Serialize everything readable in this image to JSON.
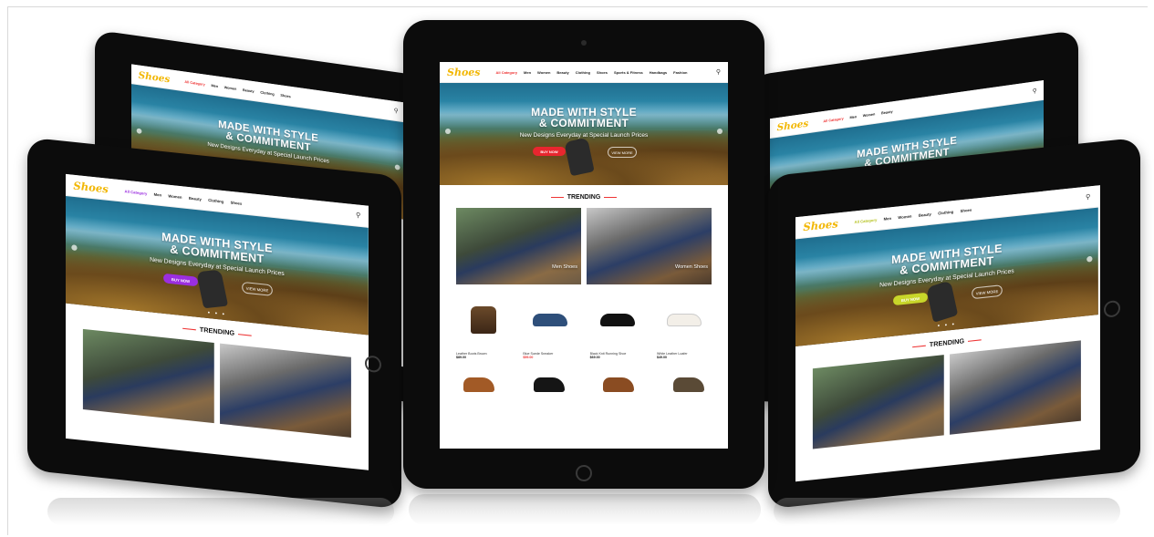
{
  "colors": {
    "accent_red": "#e8262f",
    "accent_purple": "#9b2ee0",
    "accent_lime": "#c8d62a",
    "logo_gold": "#f2b705",
    "bezel": "#0c0c0c"
  },
  "site": {
    "logo": "Shoes",
    "nav": [
      "All Category",
      "Men",
      "Women",
      "Beauty",
      "Clothing",
      "Shoes",
      "Sports & Fitness",
      "Handbags",
      "Fashion"
    ],
    "hero_title_line1": "MADE WITH STYLE",
    "hero_title_line2": "& COMMITMENT",
    "hero_subtitle": "New Designs Everyday at Special Launch Prices",
    "buy_now": "BUY NOW",
    "view_more": "VIEW MORE",
    "trending_heading": "TRENDING",
    "categories": [
      {
        "label": "Men Shoes"
      },
      {
        "label": "Women Shoes"
      }
    ],
    "products": [
      {
        "name": "Leather Boots Brown",
        "price": "$89.00",
        "icon": "boot-icon"
      },
      {
        "name": "Blue Suede Sneaker",
        "price": "$59.00",
        "icon": "sneaker-icon",
        "sale": true
      },
      {
        "name": "Black Knit Running Shoe",
        "price": "$69.00",
        "icon": "running-shoe-icon"
      },
      {
        "name": "White Leather Loafer",
        "price": "$49.00",
        "icon": "flat-shoe-icon"
      }
    ]
  }
}
